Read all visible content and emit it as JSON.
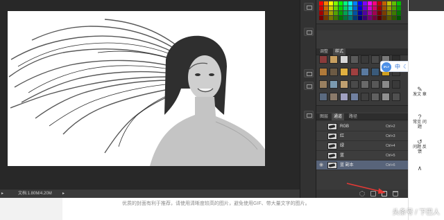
{
  "status_bar": {
    "menu_arrow": "▸",
    "doc_size": "文档:1.80M/4.20M",
    "nav_arrow": "▸"
  },
  "styles_panel": {
    "tabs": [
      "调整",
      "样式"
    ]
  },
  "channels_panel": {
    "tabs": [
      "图层",
      "通道",
      "路径"
    ],
    "rows": [
      {
        "name": "RGB",
        "shortcut": "Ctrl+2",
        "selected": false
      },
      {
        "name": "红",
        "shortcut": "Ctrl+3",
        "selected": false
      },
      {
        "name": "绿",
        "shortcut": "Ctrl+4",
        "selected": false
      },
      {
        "name": "蓝",
        "shortcut": "Ctrl+5",
        "selected": false
      },
      {
        "name": "蓝 副本",
        "shortcut": "Ctrl+6",
        "selected": true
      }
    ]
  },
  "ime_toolbar": {
    "logo": "IFLY",
    "items": [
      "中",
      "☾",
      "·",
      "♪",
      "⌸",
      "⚙"
    ]
  },
  "side_panel": {
    "items": [
      {
        "icon": "✎",
        "label": "发文 章"
      },
      {
        "icon": "?",
        "label": "常见 问题"
      },
      {
        "icon": "↺",
        "label": "问题 反馈"
      },
      {
        "icon": "∧",
        "label": ""
      }
    ]
  },
  "bottom_hint": "优质的封面有利于推荐，请使用清晰度较高的图片，避免使用GIF、带大量文字的图片。",
  "watermark": "头条号 / 下巴人",
  "colors": {
    "photoshop_bg": "#282828",
    "panel_bg": "#3a3a3a",
    "selected_row": "#58647a",
    "arrow": "#e53935",
    "ime_accent": "#4c8fe6"
  }
}
